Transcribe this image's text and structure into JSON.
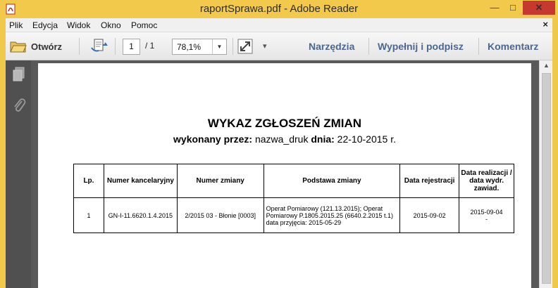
{
  "window": {
    "title": "raportSprawa.pdf - Adobe Reader",
    "minimize_glyph": "—",
    "maximize_glyph": "□",
    "close_glyph": "✕",
    "accent_color": "#f3c94b"
  },
  "menu": {
    "items": [
      "Plik",
      "Edycja",
      "Widok",
      "Okno",
      "Pomoc"
    ],
    "close_doc": "×"
  },
  "toolbar": {
    "open_label": "Otwórz",
    "page_current": "1",
    "page_total": "/ 1",
    "zoom_value": "78,1%",
    "zoom_dropdown_glyph": "▼",
    "more_glyph": "▾",
    "tools_label": "Narzędzia",
    "fill_sign_label": "Wypełnij i podpisz",
    "comment_label": "Komentarz",
    "link_color": "#4a6890"
  },
  "left_panel": {
    "icons": [
      "pages-icon",
      "attachment-icon"
    ]
  },
  "document": {
    "title": "WYKAZ ZGŁOSZEŃ ZMIAN",
    "sub_label_1": "wykonany przez:",
    "sub_value_1": " nazwa_druk ",
    "sub_label_2": "dnia:",
    "sub_value_2": " 22-10-2015 r.",
    "table": {
      "headers": [
        "Lp.",
        "Numer kancelaryjny",
        "Numer zmiany",
        "Podstawa zmiany",
        "Data rejestracji",
        "Data realizacji / data wydr. zawiad."
      ],
      "rows": [
        {
          "lp": "1",
          "numer_kancelaryjny": "GN-I-11.6620.1.4.2015",
          "numer_zmiany": "2/2015 03 - Błonie [0003]",
          "podstawa": "Operat Pomiarowy (121.13.2015); Operat Pomiarowy P.1805.2015.25 (6640.2.2015 t.1) data przyjęcia: 2015-05-29",
          "data_rejestracji": "2015-09-02",
          "data_realizacji": "2015-09-04",
          "data_wydr": "-"
        }
      ]
    }
  },
  "scrollbar": {
    "up_glyph": "▲"
  }
}
